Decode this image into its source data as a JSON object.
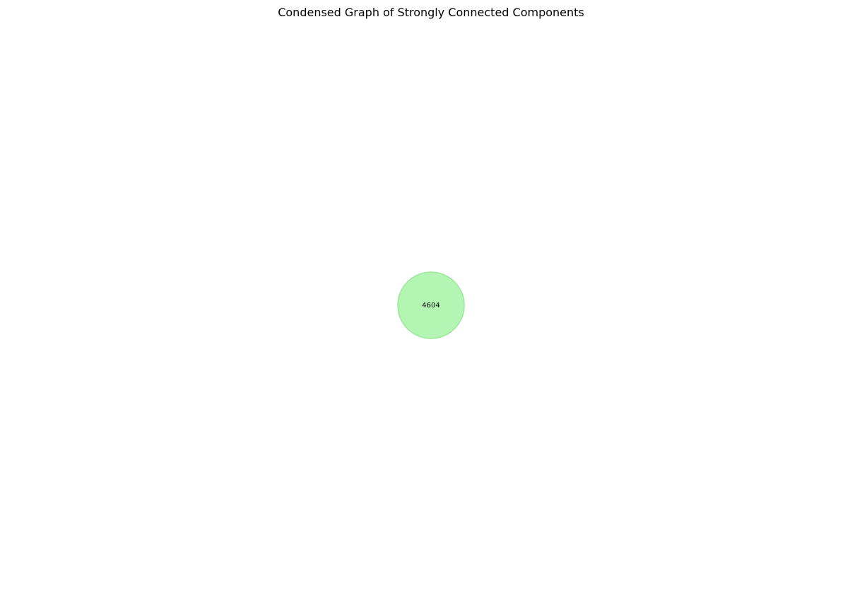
{
  "figure": {
    "title": "Condensed Graph of Strongly Connected Components"
  },
  "graph": {
    "nodes": [
      {
        "label": "4604",
        "color": "#b3f5b3",
        "edge_color": "#9ae99a"
      }
    ],
    "edges": []
  }
}
